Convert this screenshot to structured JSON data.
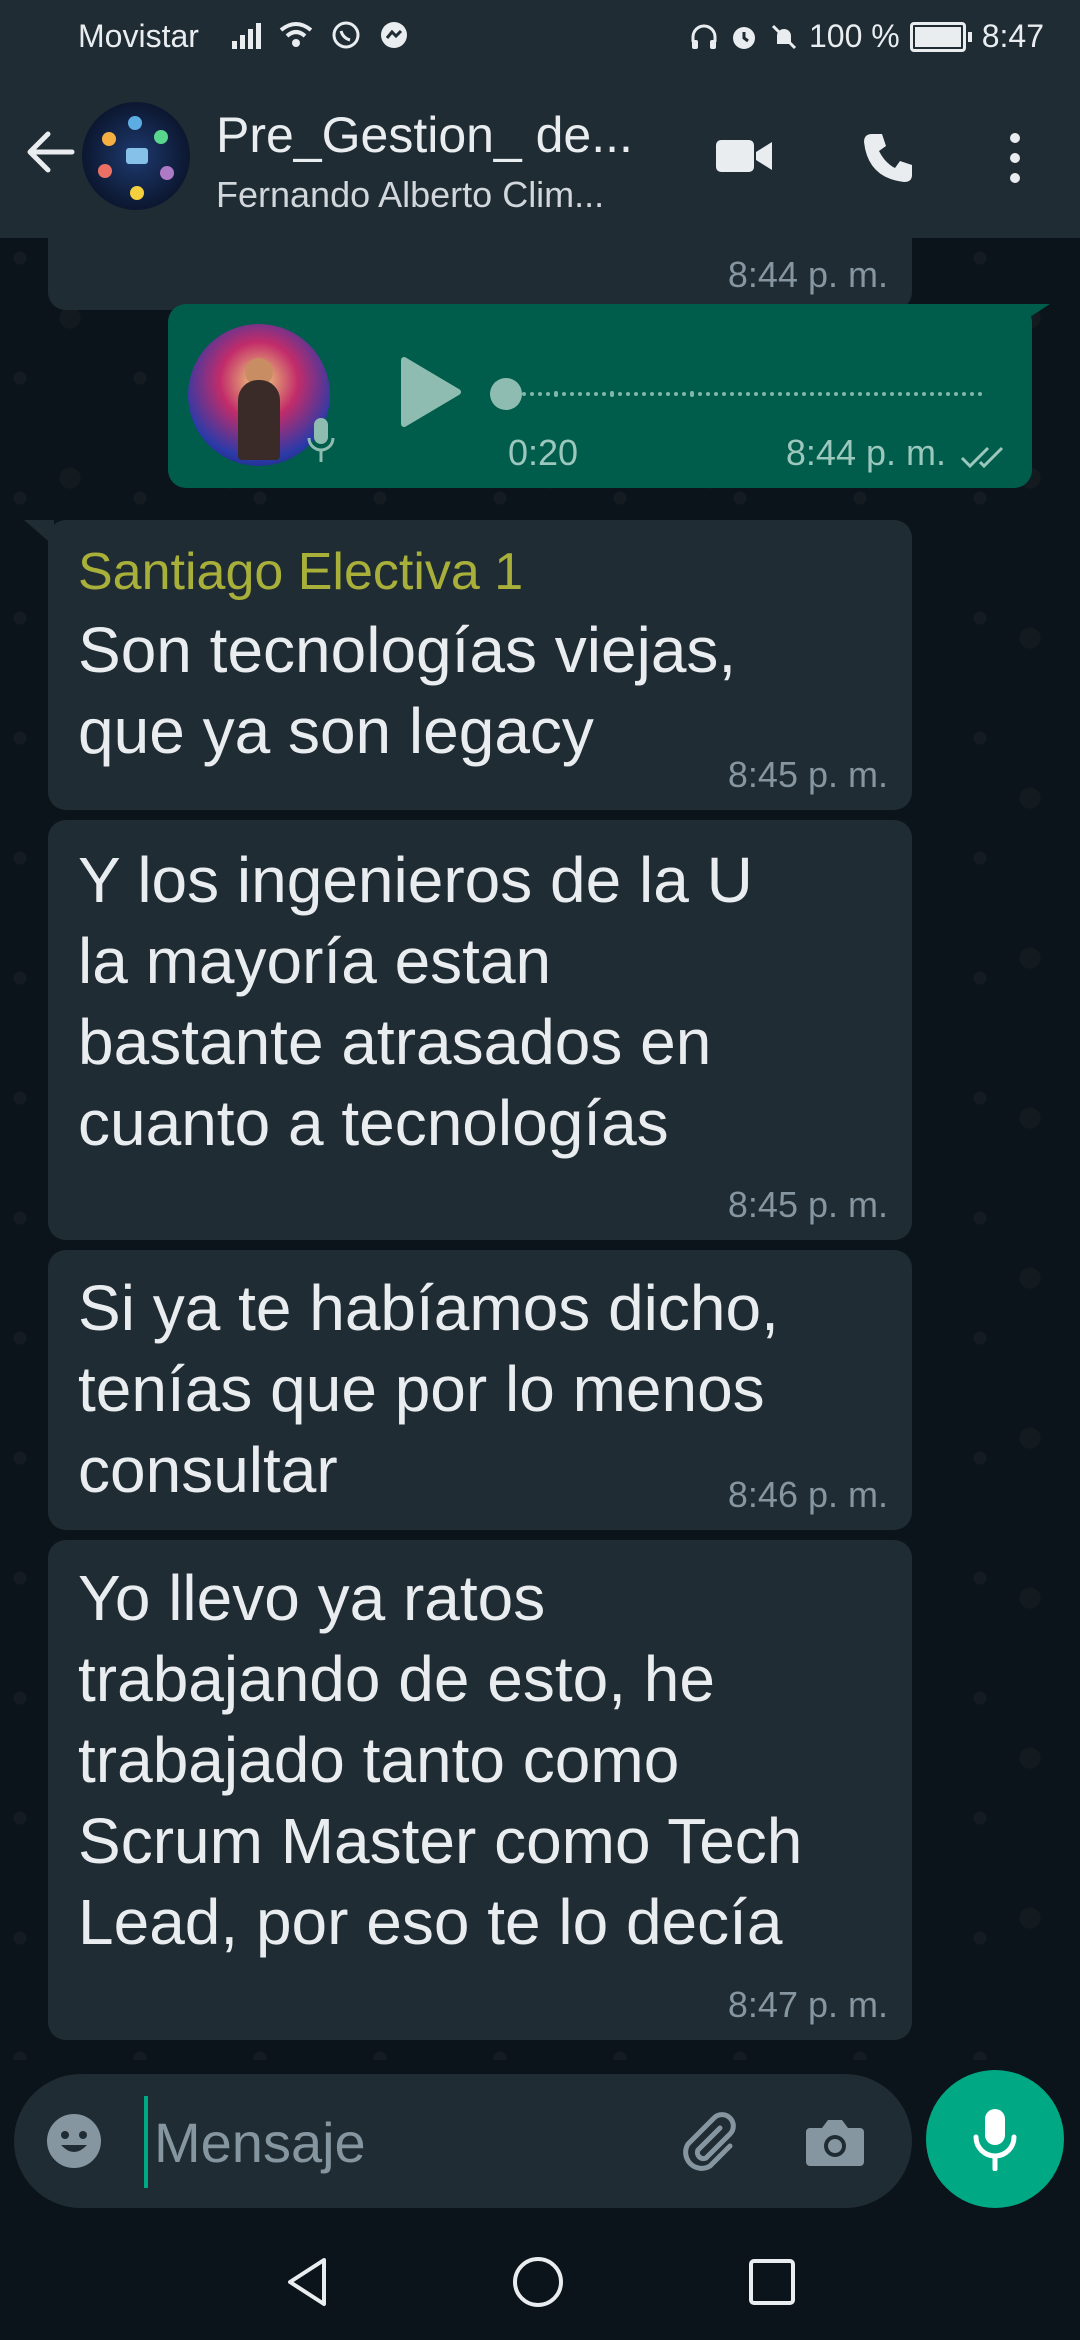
{
  "status_bar": {
    "carrier": "Movistar",
    "battery_percent": "100 %",
    "time": "8:47"
  },
  "header": {
    "title": "Pre_Gestion_ de...",
    "subtitle": "Fernando Alberto Clim..."
  },
  "messages": [
    {
      "type": "text",
      "direction": "in",
      "text": "",
      "time": "8:44 p. m.",
      "partial": true
    },
    {
      "type": "voice",
      "direction": "out",
      "duration": "0:20",
      "time": "8:44 p. m.",
      "status": "read"
    },
    {
      "type": "text",
      "direction": "in",
      "sender": "Santiago Electiva 1",
      "lines": [
        "Son tecnologías viejas,",
        "que ya son legacy"
      ],
      "time": "8:45 p. m."
    },
    {
      "type": "text",
      "direction": "in",
      "lines": [
        "Y los ingenieros de la U",
        "la mayoría estan",
        "bastante atrasados en",
        "cuanto a tecnologías"
      ],
      "time": "8:45 p. m."
    },
    {
      "type": "text",
      "direction": "in",
      "lines": [
        "Si ya te habíamos dicho,",
        "tenías que por lo menos",
        "consultar"
      ],
      "time": "8:46 p. m."
    },
    {
      "type": "text",
      "direction": "in",
      "lines": [
        "Yo llevo ya ratos",
        "trabajando de esto, he",
        "trabajado tanto como",
        "Scrum Master como Tech",
        "Lead, por eso te lo decía"
      ],
      "time": "8:47 p. m."
    }
  ],
  "composer": {
    "placeholder": "Mensaje"
  },
  "colors": {
    "background": "#0b141a",
    "header": "#1f2c34",
    "incoming_bubble": "#202c33",
    "outgoing_bubble": "#005c4b",
    "accent": "#00a884",
    "sender_name": "#a8b03a"
  }
}
